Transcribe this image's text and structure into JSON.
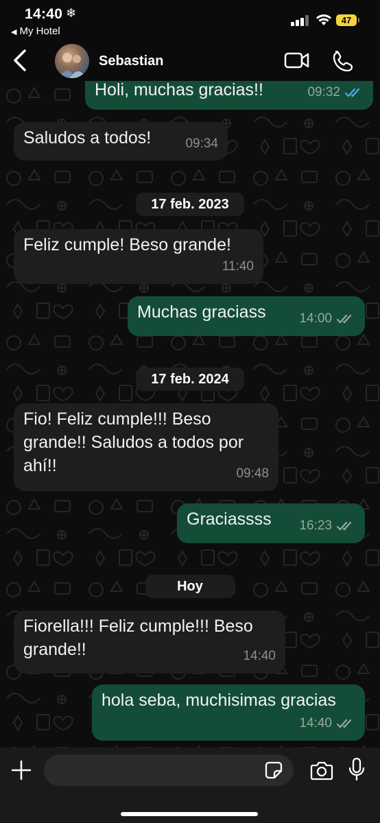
{
  "status_bar": {
    "time": "14:40",
    "time_icon": "snowflake-icon",
    "back_app_label": "My Hotel",
    "battery_level": "47"
  },
  "header": {
    "contact_name": "Sebastian",
    "icons": [
      "back-arrow-icon",
      "video-call-icon",
      "phone-icon"
    ]
  },
  "messages": [
    {
      "direction": "out",
      "text": "Holi, muchas gracias!!",
      "time": "09:32",
      "status": "read"
    },
    {
      "direction": "in",
      "text": "Saludos a todos!",
      "time": "09:34"
    },
    {
      "type": "date",
      "text": "17 feb. 2023"
    },
    {
      "direction": "in",
      "text": "Feliz cumple!  Beso grande!",
      "time": "11:40"
    },
    {
      "direction": "out",
      "text": "Muchas graciass",
      "time": "14:00",
      "status": "delivered"
    },
    {
      "type": "date",
      "text": "17 feb. 2024"
    },
    {
      "direction": "in",
      "text_lines": [
        "Fio! Feliz cumple!!! Beso",
        "grande!! Saludos a todos por",
        "ahí!!"
      ],
      "time": "09:48"
    },
    {
      "direction": "out",
      "text": "Graciassss",
      "time": "16:23",
      "status": "delivered"
    },
    {
      "type": "date",
      "text": "Hoy"
    },
    {
      "direction": "in",
      "text_lines": [
        "Fiorella!!! Feliz cumple!!! Beso",
        "grande!!"
      ],
      "time": "14:40"
    },
    {
      "direction": "out",
      "text": "hola seba, muchisimas gracias",
      "time": "14:40",
      "status": "delivered"
    }
  ],
  "colors": {
    "outgoing_bubble": "#144d37",
    "incoming_bubble": "#1e1e1e",
    "read_ticks": "#53a6ff",
    "battery": "#f4d33c"
  },
  "input_bar": {
    "placeholder": "",
    "icons": [
      "plus-icon",
      "sticker-icon",
      "camera-icon",
      "microphone-icon"
    ]
  }
}
